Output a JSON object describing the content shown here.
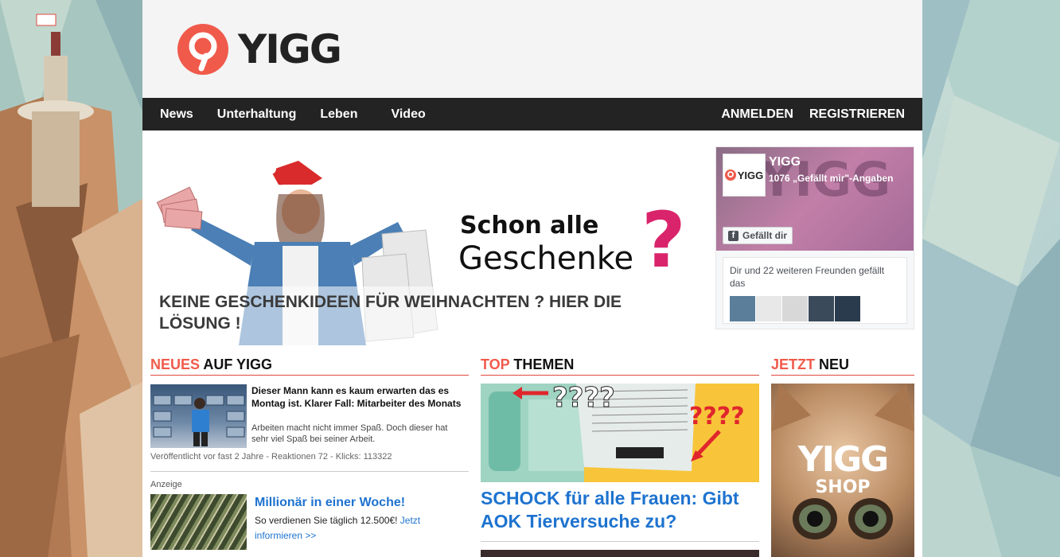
{
  "site": {
    "name": "YIGG",
    "brand_color": "#f05a4b"
  },
  "nav": {
    "items": [
      "News",
      "Unterhaltung",
      "Leben",
      "Video"
    ],
    "login": "ANMELDEN",
    "register": "REGISTRIEREN"
  },
  "hero": {
    "banner_line1": "Schon alle",
    "banner_line2": "Geschenke",
    "banner_mark": "?",
    "caption": "KEINE GESCHENKIDEEN FÜR WEIHNACHTEN ? HIER DIE LÖSUNG !"
  },
  "facebook": {
    "thumb_label": "YIGG",
    "page_name": "YIGG",
    "likes": "1076 „Gefällt mir\"-Angaben",
    "like_button": "Gefällt dir",
    "friends_text": "Dir und 22 weiteren Freunden gefällt das"
  },
  "neues": {
    "heading_highlight": "NEUES",
    "heading_rest": " AUF YIGG",
    "article": {
      "title": "Dieser Mann kann es kaum erwarten das es Montag ist. Klarer Fall: Mitarbeiter des Monats",
      "description": "Arbeiten macht nicht immer Spaß. Doch dieser hat sehr viel Spaß bei seiner Arbeit.",
      "meta": "Veröffentlicht vor fast 2 Jahre - Reaktionen 72 - Klicks: 113322"
    },
    "ad_label": "Anzeige",
    "ad": {
      "title": "Millionär in einer Woche!",
      "text": "So verdienen Sie täglich 12.500€! ",
      "link": "Jetzt informieren >>"
    }
  },
  "top": {
    "heading_highlight": "TOP",
    "heading_rest": " THEMEN",
    "image_marks_1": "????",
    "image_marks_2": "????",
    "article_title": "SCHOCK für alle Frauen: Gibt AOK Tierversuche zu?"
  },
  "jetzt": {
    "heading_highlight": "JETZT",
    "heading_rest": " NEU",
    "shop_line1": "YIGG",
    "shop_line2": "SHOP"
  }
}
